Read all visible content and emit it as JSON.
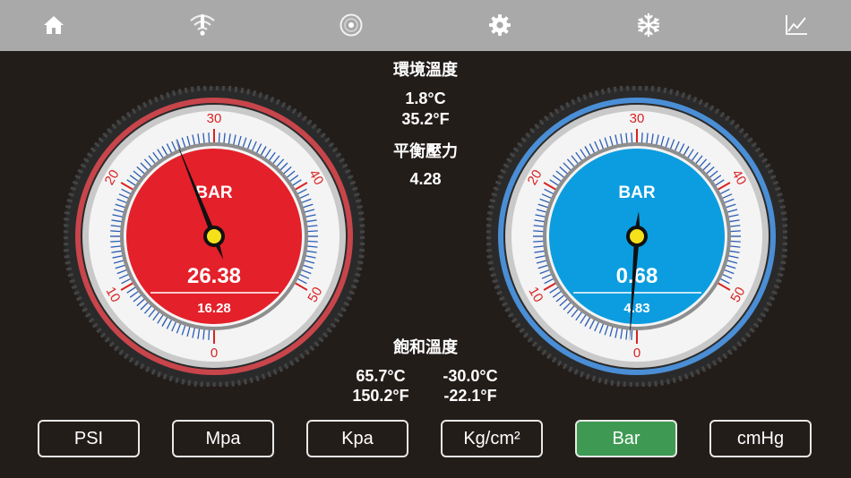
{
  "nav": {
    "items": [
      {
        "name": "home-icon"
      },
      {
        "name": "wifi-alert-icon"
      },
      {
        "name": "disc-icon"
      },
      {
        "name": "gear-icon"
      },
      {
        "name": "snowflake-icon"
      },
      {
        "name": "chart-icon"
      }
    ]
  },
  "ambient": {
    "label": "環境溫度",
    "celsius": "1.8°C",
    "fahrenheit": "35.2°F"
  },
  "equilibrium": {
    "label": "平衡壓力",
    "value": "4.28"
  },
  "saturation": {
    "label": "飽和溫度",
    "high_c": "65.7°C",
    "low_c": "-30.0°C",
    "high_f": "150.2°F",
    "low_f": "-22.1°F"
  },
  "gauges": {
    "high": {
      "unit": "BAR",
      "value": "26.38",
      "sub_value": "16.28",
      "reading": 26.38,
      "face_color": "#e4202a",
      "rim_color": "#c8454b",
      "ticks": [
        "0",
        "10",
        "20",
        "30",
        "40",
        "50"
      ]
    },
    "low": {
      "unit": "BAR",
      "value": "0.68",
      "sub_value": "4.83",
      "reading": 0.68,
      "face_color": "#0b9de0",
      "rim_color": "#4a8ed6",
      "ticks": [
        "0",
        "10",
        "20",
        "30",
        "40",
        "50"
      ]
    }
  },
  "units": {
    "psi": "PSI",
    "mpa": "Mpa",
    "kpa": "Kpa",
    "kgcm2": "Kg/cm²",
    "bar": "Bar",
    "cmhg": "cmHg",
    "active": "bar",
    "active_color": "#3e9a52"
  }
}
